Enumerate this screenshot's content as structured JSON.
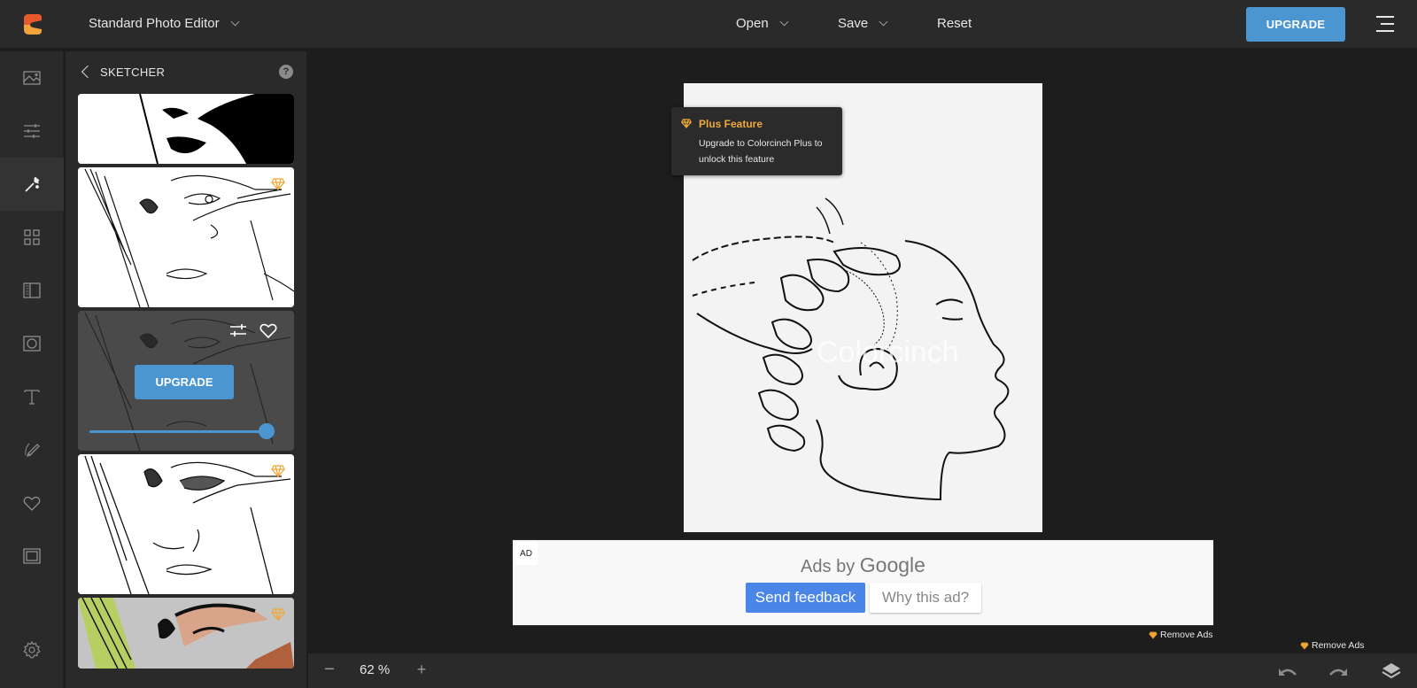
{
  "header": {
    "app_title": "Standard Photo Editor",
    "menu": [
      {
        "label": "Open"
      },
      {
        "label": "Save"
      },
      {
        "label": "Reset"
      }
    ],
    "upgrade_label": "UPGRADE"
  },
  "iconbar": {
    "items": [
      {
        "name": "image-icon",
        "label": "Image"
      },
      {
        "name": "adjust-icon",
        "label": "Adjust"
      },
      {
        "name": "effects-icon",
        "label": "Effects",
        "active": true
      },
      {
        "name": "grid-icon",
        "label": "Layout"
      },
      {
        "name": "overlay-icon",
        "label": "Overlays"
      },
      {
        "name": "frame-icon",
        "label": "Frames"
      },
      {
        "name": "text-icon",
        "label": "Text"
      },
      {
        "name": "draw-icon",
        "label": "Draw"
      },
      {
        "name": "heart-icon",
        "label": "Favorites"
      },
      {
        "name": "border-icon",
        "label": "Borders"
      },
      {
        "name": "settings-icon",
        "label": "Settings"
      }
    ]
  },
  "panel": {
    "title": "SKETCHER",
    "help_label": "?",
    "thumbnails": [
      {
        "style": "bw-contrast",
        "plus": false
      },
      {
        "style": "pencil-sketch",
        "plus": true
      },
      {
        "style": "selected-sketch",
        "plus": true,
        "upgrade_label": "UPGRADE",
        "intensity": 1.0
      },
      {
        "style": "ink-sketch",
        "plus": true
      },
      {
        "style": "crumpled-paper-color",
        "plus": true
      }
    ]
  },
  "canvas": {
    "watermark": "Colorcinch",
    "tooltip": {
      "title": "Plus Feature",
      "body": "Upgrade to Colorcinch Plus to unlock this feature"
    }
  },
  "ad": {
    "tag": "AD",
    "ads_by": "Ads by",
    "google": "Google",
    "send_feedback": "Send feedback",
    "why_ad": "Why this ad?",
    "remove_ads": "Remove Ads"
  },
  "footer": {
    "zoom_minus": "−",
    "zoom_level": "62 %",
    "zoom_plus": "+",
    "remove_ads": "Remove Ads"
  },
  "colors": {
    "accent": "#4b96d1",
    "plus": "#f0a83a",
    "google_blue": "#4a86e8"
  }
}
